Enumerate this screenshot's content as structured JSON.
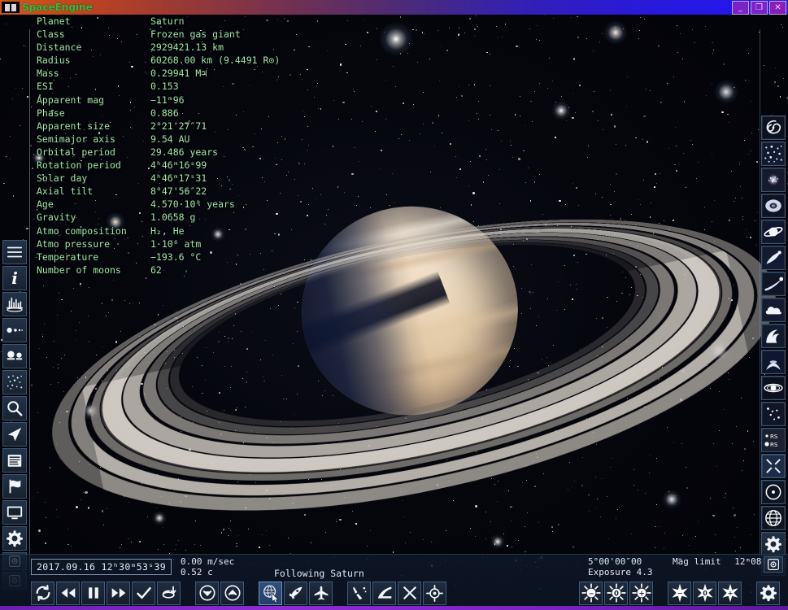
{
  "window": {
    "title": "SpaceEngine",
    "app_icon": "spaceengine-icon",
    "controls": {
      "minimize": "_",
      "maximize": "❐",
      "close": "✕"
    }
  },
  "info_panel": {
    "rows": [
      {
        "key": "Planet",
        "value": "Saturn"
      },
      {
        "key": "Class",
        "value": "Frozen gas giant"
      },
      {
        "key": "Distance",
        "value": "2929421.13 km"
      },
      {
        "key": "Radius",
        "value": "60268.00 km (9.4491 R⊙)"
      },
      {
        "key": "Mass",
        "value": "0.29941 M♃"
      },
      {
        "key": "ESI",
        "value": "0.153"
      },
      {
        "key": "Apparent mag",
        "value": "−11ᵐ96"
      },
      {
        "key": "Phase",
        "value": "0.886"
      },
      {
        "key": "Apparent size",
        "value": "2°21'27″71"
      },
      {
        "key": "Semimajor axis",
        "value": "9.54 AU"
      },
      {
        "key": "Orbital period",
        "value": "29.486 years"
      },
      {
        "key": "Rotation period",
        "value": "4ʰ46ᵐ16ˢ99"
      },
      {
        "key": "Solar day",
        "value": "4ʰ46ᵐ17ˢ31"
      },
      {
        "key": "Axial tilt",
        "value": "8°47'56″22"
      },
      {
        "key": "Age",
        "value": "4.570·10⁹ years"
      },
      {
        "key": "Gravity",
        "value": "1.0658 g"
      },
      {
        "key": "Atmo composition",
        "value": "H₂, He"
      },
      {
        "key": "Atmo pressure",
        "value": "1·10⁶ atm"
      },
      {
        "key": "Temperature",
        "value": "−193.6 °C"
      },
      {
        "key": "Number of moons",
        "value": "62"
      }
    ]
  },
  "status_bar": {
    "datetime": "2017.09.16  12ʰ30ᵐ53ˢ39",
    "speed_mps": "0.00 m/sec",
    "speed_c": "0.52 c",
    "following": "Following Saturn",
    "fov": "5°00'00″00",
    "exposure": "Exposure 4.3",
    "mag_limit_label": "Mag limit",
    "mag_limit_value": "12ᵐ08"
  },
  "left_sidebar": {
    "items": [
      {
        "name": "menu-icon",
        "label": "Main menu"
      },
      {
        "name": "info-icon",
        "label": "Object info"
      },
      {
        "name": "spectrum-icon",
        "label": "Spectrum"
      },
      {
        "name": "orbits-icon",
        "label": "Planetary system"
      },
      {
        "name": "compare-icon",
        "label": "Compare objects"
      },
      {
        "name": "starmap-icon",
        "label": "Star map"
      },
      {
        "name": "search-icon",
        "label": "Search"
      },
      {
        "name": "navigation-icon",
        "label": "Navigation"
      },
      {
        "name": "journal-icon",
        "label": "Wiki / journal"
      },
      {
        "name": "flag-icon",
        "label": "Locations"
      },
      {
        "name": "display-icon",
        "label": "Display settings"
      },
      {
        "name": "gear-icon",
        "label": "Settings"
      },
      {
        "name": "capture-icon",
        "label": "Screenshot"
      },
      {
        "name": "record-icon",
        "label": "Record video"
      }
    ]
  },
  "right_sidebar": {
    "items": [
      {
        "name": "galaxy-icon",
        "label": "Galaxies"
      },
      {
        "name": "stars-icon",
        "label": "Stars"
      },
      {
        "name": "cluster-icon",
        "label": "Star clusters"
      },
      {
        "name": "nebula-icon",
        "label": "Nebulae"
      },
      {
        "name": "planet-rings-icon",
        "label": "Planets"
      },
      {
        "name": "comet-icon",
        "label": "Comets"
      },
      {
        "name": "meteor-icon",
        "label": "Meteors"
      },
      {
        "name": "cloud-icon",
        "label": "Clouds"
      },
      {
        "name": "aurora-icon",
        "label": "Aurorae"
      },
      {
        "name": "jets-icon",
        "label": "Jets"
      },
      {
        "name": "ring-system-icon",
        "label": "Ring system"
      },
      {
        "name": "asterism-icon",
        "label": "Asterisms"
      },
      {
        "name": "labels-rs-icon",
        "label": "RS",
        "sublabel": "RS"
      },
      {
        "name": "sparkle-icon",
        "label": "Diffraction spikes"
      },
      {
        "name": "orbit-point-icon",
        "label": "Orbit markers"
      },
      {
        "name": "grid-icon",
        "label": "Grids"
      },
      {
        "name": "gear-icon",
        "label": "Graphics settings"
      },
      {
        "name": "capture-icon",
        "label": "Screenshot"
      }
    ]
  },
  "toolbar": {
    "time_group": [
      {
        "name": "time-reverse-icon",
        "label": "Reverse time"
      },
      {
        "name": "rewind-icon",
        "label": "Slow down"
      },
      {
        "name": "pause-icon",
        "label": "Pause"
      },
      {
        "name": "fast-forward-icon",
        "label": "Speed up"
      },
      {
        "name": "realtime-icon",
        "label": "Real time"
      },
      {
        "name": "reset-time-icon",
        "label": "Reset time"
      }
    ],
    "step_group": [
      {
        "name": "chevron-down-icon",
        "label": "Decrease"
      },
      {
        "name": "chevron-up-icon",
        "label": "Increase"
      }
    ],
    "mode_group": [
      {
        "name": "free-cursor-icon",
        "label": "Free flight",
        "active": true
      },
      {
        "name": "spacecraft-icon",
        "label": "Spacecraft mode",
        "active": false
      },
      {
        "name": "aircraft-icon",
        "label": "Aircraft mode",
        "active": false
      }
    ],
    "nav_group": [
      {
        "name": "land-icon",
        "label": "Land on surface"
      },
      {
        "name": "orbit-icon",
        "label": "Go to orbit"
      },
      {
        "name": "follow-icon",
        "label": "Stop following"
      },
      {
        "name": "center-target-icon",
        "label": "Center target"
      }
    ],
    "exposure_group": [
      {
        "name": "exposure-down-icon",
        "label": "−"
      },
      {
        "name": "exposure-auto-icon",
        "label": "0"
      },
      {
        "name": "exposure-up-icon",
        "label": "+"
      }
    ],
    "mag_group": [
      {
        "name": "mag-down-icon",
        "label": "−"
      },
      {
        "name": "mag-auto-icon",
        "label": "0"
      },
      {
        "name": "mag-up-icon",
        "label": "+"
      }
    ],
    "settings": {
      "name": "gear-icon",
      "label": "Settings"
    }
  },
  "colors": {
    "info_text": "#9fe6a8",
    "status_text": "#dfe9f5",
    "accent_purple": "#8f2bd6",
    "title_green": "#2fbe3f",
    "panel_bg": "#17222f",
    "panel_border": "#3c5670"
  }
}
